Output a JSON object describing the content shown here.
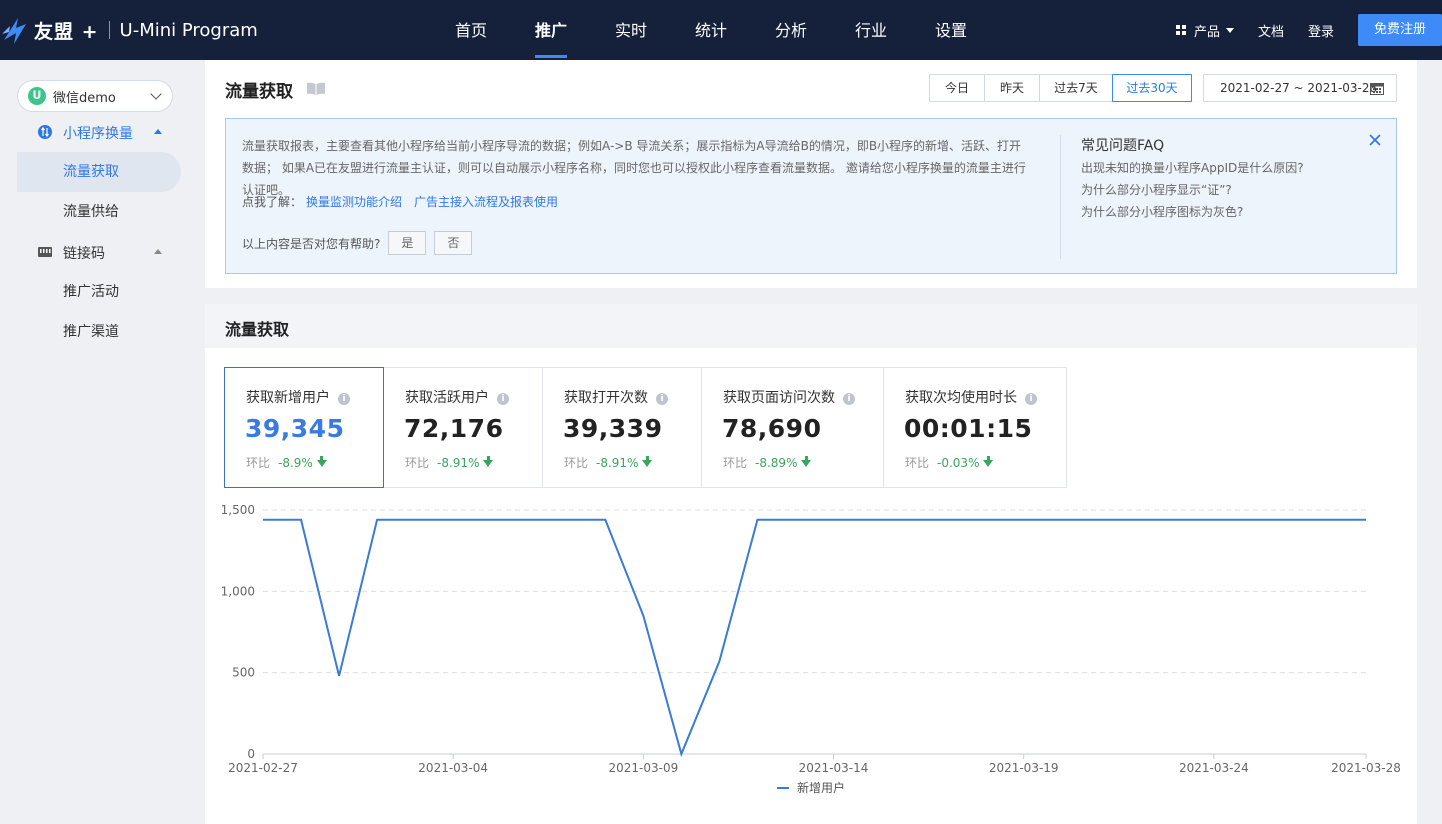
{
  "header": {
    "brand": "友盟 +",
    "product": "U-Mini Program",
    "nav": [
      "首页",
      "推广",
      "实时",
      "统计",
      "分析",
      "行业",
      "设置"
    ],
    "nav_active": 1,
    "product_menu": "产品",
    "docs": "文档",
    "login": "登录",
    "signup": "免费注册"
  },
  "sidebar": {
    "app_name": "微信demo",
    "app_badge": "",
    "groups": [
      {
        "label": "小程序换量",
        "icon": "exchange-icon",
        "items": [
          "流量获取",
          "流量供给"
        ]
      },
      {
        "label": "链接码",
        "icon": "barcode-icon",
        "items": [
          "推广活动",
          "推广渠道"
        ]
      }
    ],
    "active_item": "流量获取"
  },
  "page": {
    "title": "流量获取",
    "ranges": [
      "今日",
      "昨天",
      "过去7天",
      "过去30天"
    ],
    "active_range": 3,
    "date_range": "2021-02-27 ~ 2021-03-28"
  },
  "info": {
    "text": "流量获取报表，主要查看其他小程序给当前小程序导流的数据；例如A->B 导流关系；展示指标为A导流给B的情况，即B小程序的新增、活跃、打开数据； 如果A已在友盟进行流量主认证，则可以自动展示小程序名称，同时您也可以授权此小程序查看流量数据。 邀请给您小程序换量的流量主进行认证吧。",
    "learn_label": "点我了解：",
    "links": [
      "换量监测功能介绍",
      "广告主接入流程及报表使用"
    ],
    "helpful_q": "以上内容是否对您有帮助?",
    "yes": "是",
    "no": "否",
    "faq_title": "常见问题FAQ",
    "faq": [
      "出现未知的换量小程序AppID是什么原因?",
      "为什么部分小程序显示“证”?",
      "为什么部分小程序图标为灰色?"
    ]
  },
  "section": {
    "title": "流量获取",
    "compare_label": "环比"
  },
  "kpis": [
    {
      "label": "获取新增用户",
      "value": "39,345",
      "change": "-8.9%"
    },
    {
      "label": "获取活跃用户",
      "value": "72,176",
      "change": "-8.91%"
    },
    {
      "label": "获取打开次数",
      "value": "39,339",
      "change": "-8.91%"
    },
    {
      "label": "获取页面访问次数",
      "value": "78,690",
      "change": "-8.89%"
    },
    {
      "label": "获取次均使用时长",
      "value": "00:01:15",
      "change": "-0.03%"
    }
  ],
  "chart_data": {
    "type": "line",
    "x": [
      "2021-02-27",
      "2021-02-28",
      "2021-03-01",
      "2021-03-02",
      "2021-03-03",
      "2021-03-04",
      "2021-03-05",
      "2021-03-06",
      "2021-03-07",
      "2021-03-08",
      "2021-03-09",
      "2021-03-10",
      "2021-03-11",
      "2021-03-12",
      "2021-03-13",
      "2021-03-14",
      "2021-03-15",
      "2021-03-16",
      "2021-03-17",
      "2021-03-18",
      "2021-03-19",
      "2021-03-20",
      "2021-03-21",
      "2021-03-22",
      "2021-03-23",
      "2021-03-24",
      "2021-03-25",
      "2021-03-26",
      "2021-03-27",
      "2021-03-28"
    ],
    "x_ticks": [
      "2021-02-27",
      "2021-03-04",
      "2021-03-09",
      "2021-03-14",
      "2021-03-19",
      "2021-03-24",
      "2021-03-28"
    ],
    "series": [
      {
        "name": "新增用户",
        "color": "#3a7bd5",
        "values": [
          1440,
          1440,
          480,
          1440,
          1440,
          1440,
          1440,
          1440,
          1440,
          1440,
          850,
          0,
          570,
          1440,
          1440,
          1440,
          1440,
          1440,
          1440,
          1440,
          1440,
          1440,
          1440,
          1440,
          1440,
          1440,
          1440,
          1440,
          1440,
          1440
        ]
      }
    ],
    "y_ticks": [
      "0",
      "500",
      "1,000",
      "1,500"
    ],
    "ylim": [
      0,
      1500
    ],
    "grid": true,
    "legend": "bottom-center"
  }
}
